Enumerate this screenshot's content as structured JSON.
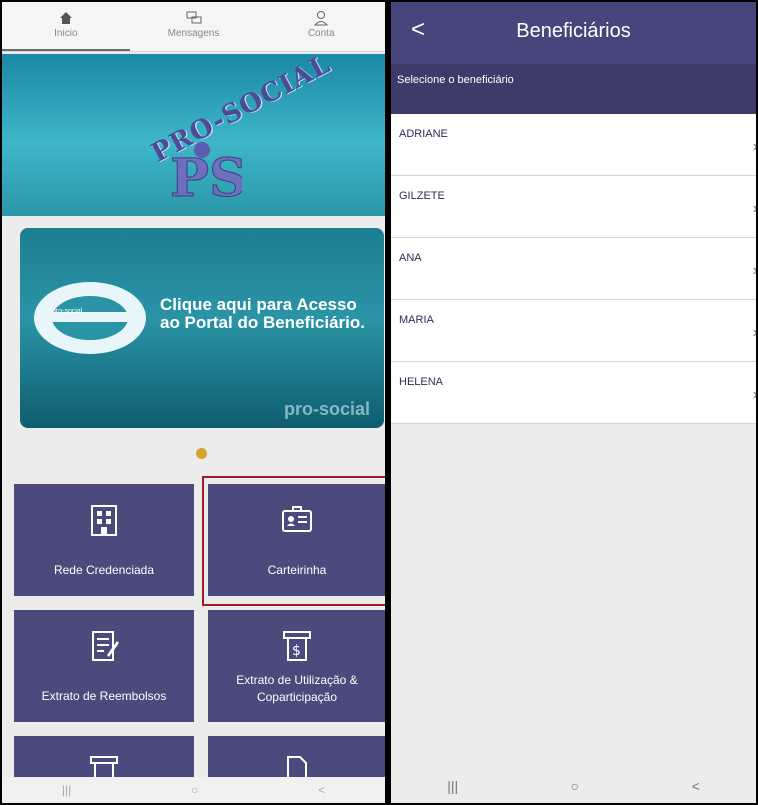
{
  "left_screen": {
    "top_nav": [
      {
        "label": "Inicio",
        "icon": "home-icon"
      },
      {
        "label": "Mensagens",
        "icon": "chat-icon"
      },
      {
        "label": "Conta",
        "icon": "user-icon"
      }
    ],
    "banner1_logo": "PRO-SOCIAL",
    "banner2": {
      "title": "Clique aqui para Acesso ao Portal do Beneficiário.",
      "mini_brand": "pro-social",
      "brand": "pro-social"
    },
    "tiles": [
      {
        "label": "Rede Credenciada",
        "icon": "building-icon"
      },
      {
        "label": "Carteirinha",
        "icon": "id-card-icon"
      },
      {
        "label": "Extrato de Reembolsos",
        "icon": "document-edit-icon"
      },
      {
        "label": "Extrato de Utilização & Coparticipação",
        "icon": "receipt-dollar-icon"
      }
    ],
    "bottom_nav": [
      "|||",
      "○",
      "<"
    ]
  },
  "right_screen": {
    "title": "Beneficiários",
    "back": "<",
    "subtitle": "Selecione o beneficiário",
    "beneficiaries": [
      "ADRIANE",
      "GILZETE",
      "ANA",
      "MARIA",
      "HELENA"
    ],
    "bottom_nav": [
      "|||",
      "○",
      "<"
    ]
  },
  "colors": {
    "primary": "#46457c",
    "tile": "#4a4a7d",
    "highlight": "#a31e2a",
    "dot": "#d6a12e"
  }
}
